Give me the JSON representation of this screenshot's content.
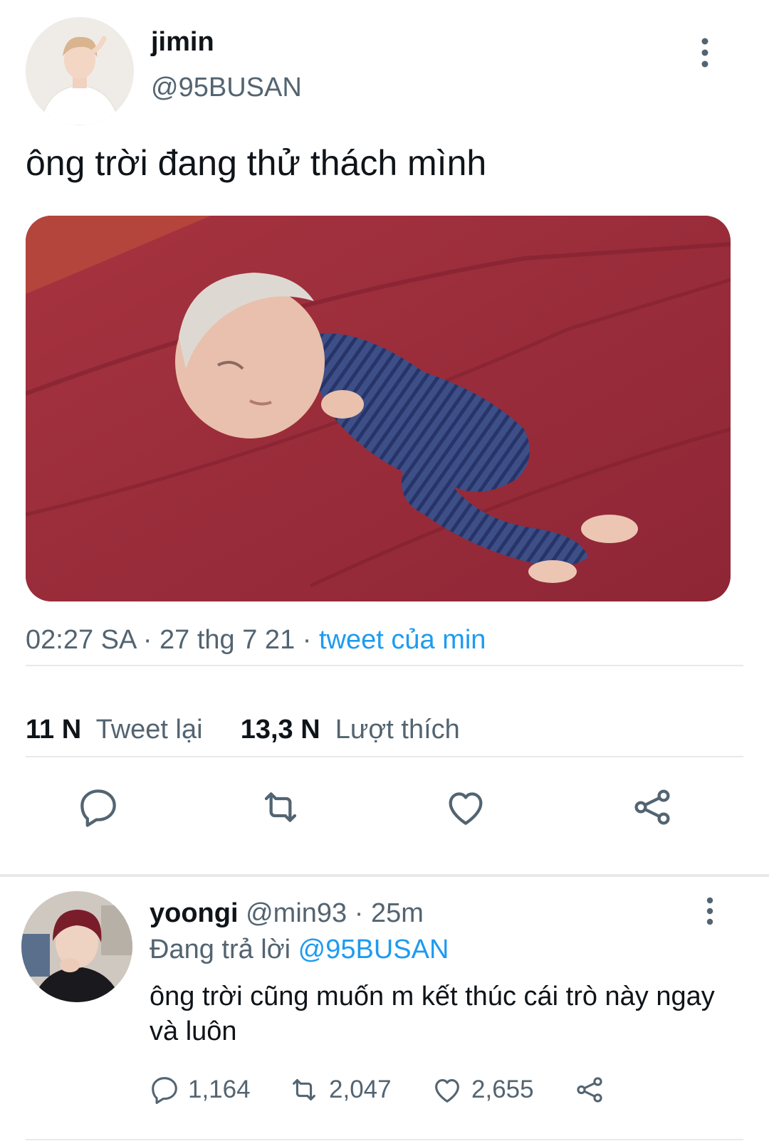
{
  "main_tweet": {
    "author_name": "jimin",
    "author_handle": "@95BUSAN",
    "text": "ông trời đang thử thách mình",
    "time": "02:27 SA",
    "date": "27 thg 7 21",
    "source": "tweet của min",
    "retweets_count": "11 N",
    "retweets_label": "Tweet lại",
    "likes_count": "13,3 N",
    "likes_label": "Lượt thích",
    "actions": [
      "reply-icon",
      "retweet-icon",
      "like-icon",
      "share-icon"
    ]
  },
  "reply": {
    "author_name": "yoongi",
    "author_handle": "@min93",
    "age": "25m",
    "replying_to_label": "Đang trả lời",
    "replying_to_handle": "@95BUSAN",
    "text": "ông trời cũng muốn m kết thúc cái trò này ngay và luôn",
    "reply_count": "1,164",
    "retweet_count": "2,047",
    "like_count": "2,655"
  },
  "colors": {
    "accent": "#1d9bf0",
    "secondary_text": "#536471",
    "divider": "#e7e9ea",
    "media_background": "#9a2e3c"
  }
}
